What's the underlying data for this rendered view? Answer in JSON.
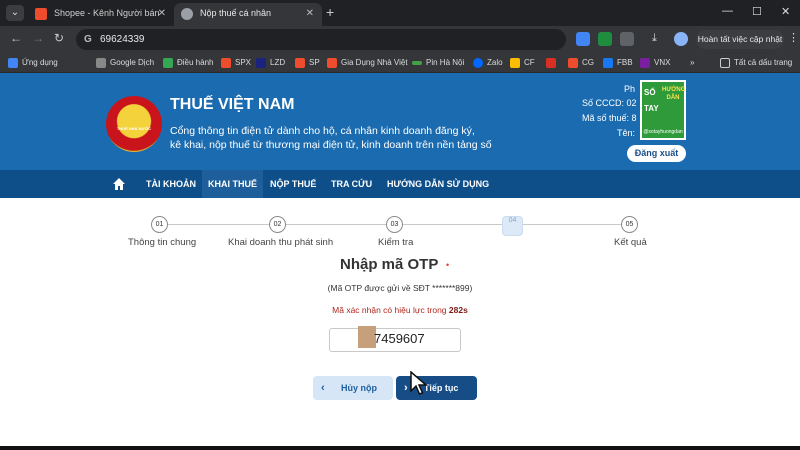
{
  "browser": {
    "tabs": [
      {
        "title": "Shopee - Kênh Người bán",
        "active": false
      },
      {
        "title": "Nộp thuế cá nhân",
        "active": true
      }
    ],
    "address": "69624339",
    "update_label": "Hoàn tất việc cập nhật",
    "bookmarks": [
      {
        "label": "Ứng dụng"
      },
      {
        "label": "Google Dịch"
      },
      {
        "label": "Điều hành"
      },
      {
        "label": "SPX"
      },
      {
        "label": "LZD"
      },
      {
        "label": "SP"
      },
      {
        "label": "Gia Dụng Nhà Việt"
      },
      {
        "label": "Pin Hà Nội"
      },
      {
        "label": "Zalo"
      },
      {
        "label": "CF"
      },
      {
        "label": "CG"
      },
      {
        "label": "FBB"
      },
      {
        "label": "VNX"
      },
      {
        "label": "Tất cả dấu trang"
      }
    ]
  },
  "site": {
    "brand": "THUẾ VIỆT NAM",
    "emblem_text": "THUẾ NHÀ NƯỚC",
    "subtitle_line1": "Cổng thông tin điện tử dành cho hộ, cá nhân kinh doanh đăng ký,",
    "subtitle_line2": "kê khai, nộp thuế từ thương mại điện tử, kinh doanh trên nền tảng số",
    "user_line1": "Ph",
    "user_line2": "Số CCCD: 02",
    "user_line3": "Mã số thuế: 8",
    "user_line4": "Tên:",
    "logout_label": "Đăng xuất",
    "watermark": {
      "word1": "SỔ",
      "word2": "TAY",
      "word3": "HƯỚNG DẪN",
      "handle": "@sotayhuongdan"
    }
  },
  "nav": {
    "items": [
      "TÀI KHOẢN",
      "KHAI THUẾ",
      "NỘP THUẾ",
      "TRA CỨU",
      "HƯỚNG DẪN SỬ DỤNG"
    ],
    "active_index": 1
  },
  "stepper": {
    "steps": [
      {
        "number": "01",
        "label": "Thông tin chung"
      },
      {
        "number": "02",
        "label": "Khai doanh thu phát sinh"
      },
      {
        "number": "03",
        "label": "Kiểm tra"
      },
      {
        "number": "04",
        "label": ""
      },
      {
        "number": "05",
        "label": "Kết quả"
      }
    ],
    "current": 4
  },
  "otp": {
    "title": "Nhập mã OTP",
    "required_mark": "•",
    "sent_note": "(Mã OTP được gửi về SĐT *******899)",
    "validity_prefix": "Mã xác nhận có hiệu lực trong",
    "validity_seconds": "282s",
    "value_visible": "7459607",
    "back_label": "Hủy nộp",
    "next_label": "Tiếp tục"
  },
  "colors": {
    "header_blue": "#1b6bb0",
    "nav_blue": "#0e4f89",
    "primary_button": "#164d86",
    "secondary_button": "#d6e6f6",
    "timer_red": "#b0271f"
  }
}
